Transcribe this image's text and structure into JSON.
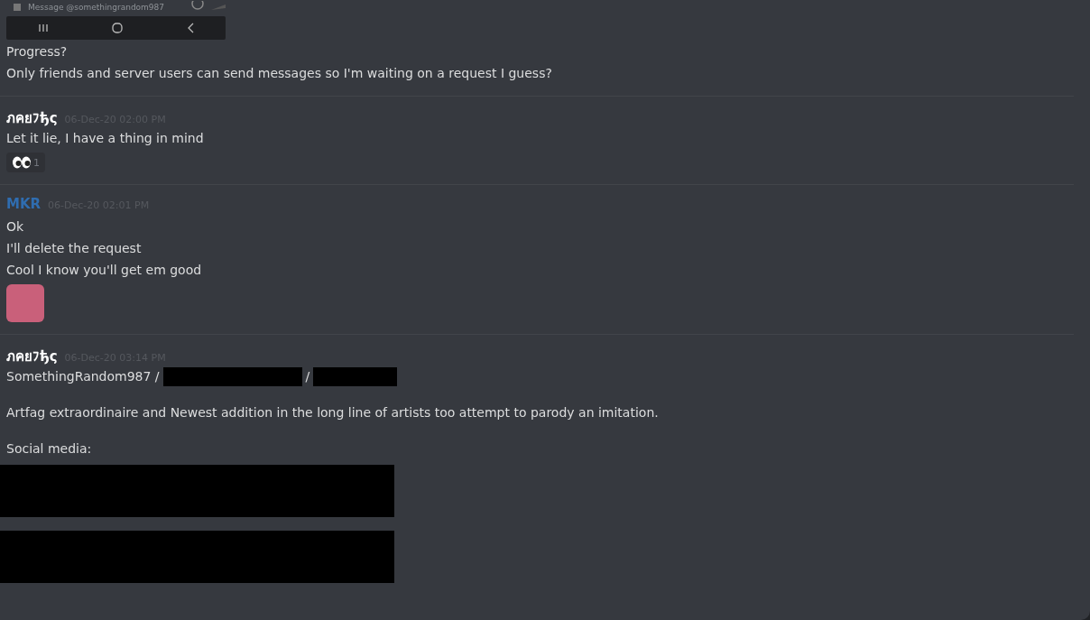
{
  "embedded_phone": {
    "message_placeholder": "Message @somethingrandom987"
  },
  "first_message_lines": [
    "Progress?",
    "Only friends and server users can send messages so I'm waiting on a request I guess?"
  ],
  "messages": [
    {
      "author": "ภคยﾌђς",
      "color": "#ffffff",
      "timestamp": "06-Dec-20 02:00 PM",
      "lines": [
        {
          "kind": "text",
          "text": "Let it lie, I have a thing in mind"
        },
        {
          "kind": "reaction",
          "count": "1"
        }
      ]
    },
    {
      "author": "MKR",
      "color": "#2f6db0",
      "timestamp": "06-Dec-20 02:01 PM",
      "lines": [
        {
          "kind": "text",
          "text": "Ok"
        },
        {
          "kind": "text",
          "text": "I'll delete the request"
        },
        {
          "kind": "text",
          "text": "Cool I know you'll get em good"
        },
        {
          "kind": "sticker"
        }
      ]
    },
    {
      "author": "ภคยﾌђς",
      "color": "#ffffff",
      "timestamp": "06-Dec-20 03:14 PM",
      "lines": [
        {
          "kind": "handles",
          "text": "SomethingRandom987 /",
          "separator": "/"
        },
        {
          "kind": "gap"
        },
        {
          "kind": "text",
          "text": "Artfag extraordinaire and Newest addition in the long line of artists too attempt to parody an imitation."
        },
        {
          "kind": "gap"
        },
        {
          "kind": "text",
          "text": "Social media:"
        },
        {
          "kind": "redacted"
        },
        {
          "kind": "redacted"
        }
      ]
    }
  ]
}
